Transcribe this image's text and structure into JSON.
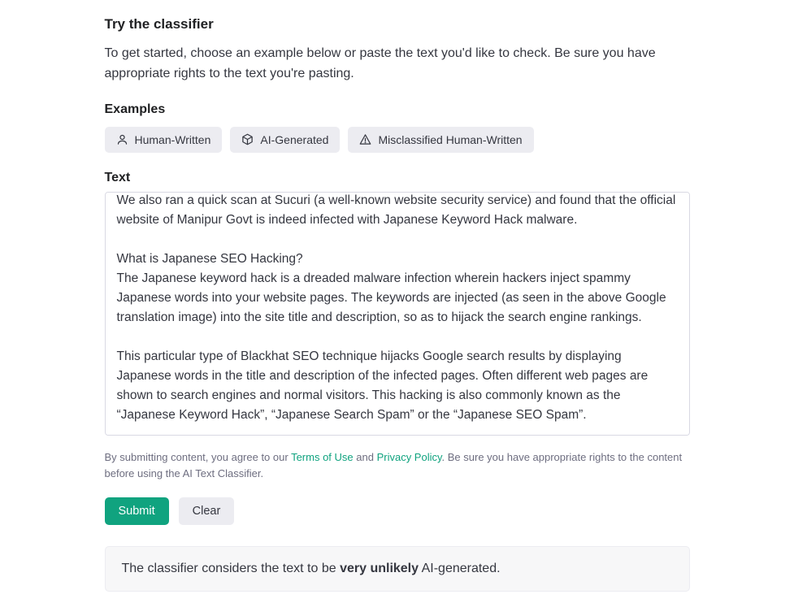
{
  "header": {
    "title": "Try the classifier",
    "intro": "To get started, choose an example below or paste the text you'd like to check. Be sure you have appropriate rights to the text you're pasting."
  },
  "examples": {
    "heading": "Examples",
    "chips": [
      {
        "label": "Human-Written",
        "icon": "person-icon"
      },
      {
        "label": "AI-Generated",
        "icon": "cube-icon"
      },
      {
        "label": "Misclassified Human-Written",
        "icon": "warning-icon"
      }
    ]
  },
  "text_section": {
    "label": "Text",
    "value": "We also ran a quick scan at Sucuri (a well-known website security service) and found that the official website of Manipur Govt is indeed infected with Japanese Keyword Hack malware.\n\nWhat is Japanese SEO Hacking?\nThe Japanese keyword hack is a dreaded malware infection wherein hackers inject spammy Japanese words into your website pages. The keywords are injected (as seen in the above Google translation image) into the site title and description, so as to hijack the search engine rankings.\n\nThis particular type of Blackhat SEO technique hijacks Google search results by displaying Japanese words in the title and description of the infected pages. Often different web pages are shown to search engines and normal visitors. This hacking is also commonly known as the “Japanese Keyword Hack”, “Japanese Search Spam” or the “Japanese SEO Spam”."
  },
  "tos": {
    "pre": "By submitting content, you agree to our ",
    "terms": "Terms of Use",
    "mid": " and ",
    "privacy": "Privacy Policy",
    "post": ". Be sure you have appropriate rights to the content before using the AI Text Classifier."
  },
  "actions": {
    "submit": "Submit",
    "clear": "Clear"
  },
  "result": {
    "pre": "The classifier considers the text to be ",
    "verdict": "very unlikely",
    "post": " AI-generated."
  }
}
